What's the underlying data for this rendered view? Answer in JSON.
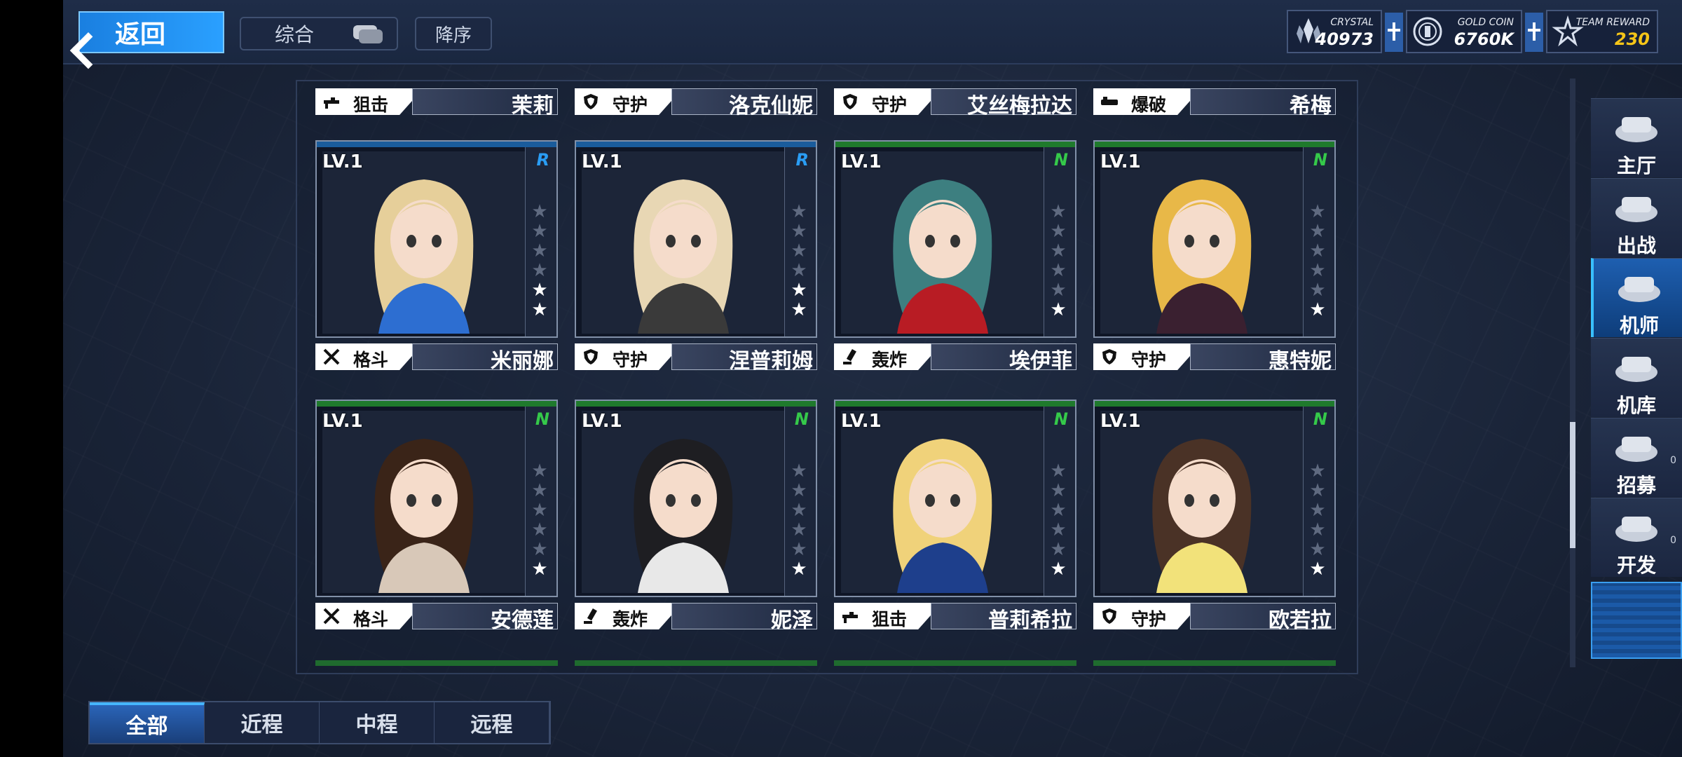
{
  "topbar": {
    "back_label": "返回",
    "filter_label": "综合",
    "sort_label": "降序"
  },
  "currencies": [
    {
      "label": "CRYSTAL",
      "value": "40973",
      "color": "#ffffff"
    },
    {
      "label": "GOLD COIN",
      "value": "6760K",
      "color": "#ffffff"
    },
    {
      "label": "TEAM REWARD",
      "value": "230",
      "color": "#f5c518"
    }
  ],
  "class_labels": {
    "snipe": "狙击",
    "guard": "守护",
    "blast": "爆破",
    "melee": "格斗",
    "bomb": "轰炸"
  },
  "top_row_tags": [
    {
      "class": "狙击",
      "name": "茉莉"
    },
    {
      "class": "守护",
      "name": "洛克仙妮"
    },
    {
      "class": "守护",
      "name": "艾丝梅拉达"
    },
    {
      "class": "爆破",
      "name": "希梅"
    }
  ],
  "cards": [
    {
      "level": "LV.1",
      "rarity": "R",
      "rarity_color": "#2a9df4",
      "stars_on": 2,
      "class": "格斗",
      "name": "米丽娜",
      "top_color": "#1a5c9c",
      "palette": [
        "#e6cf9a",
        "#2d6ed1"
      ]
    },
    {
      "level": "LV.1",
      "rarity": "R",
      "rarity_color": "#2a9df4",
      "stars_on": 2,
      "class": "守护",
      "name": "涅普莉姆",
      "top_color": "#1a5c9c",
      "palette": [
        "#e8d7b4",
        "#3a3a3a"
      ]
    },
    {
      "level": "LV.1",
      "rarity": "N",
      "rarity_color": "#35c94a",
      "stars_on": 1,
      "class": "轰炸",
      "name": "埃伊菲",
      "top_color": "#1f7a2c",
      "palette": [
        "#3d7f80",
        "#b81c24"
      ]
    },
    {
      "level": "LV.1",
      "rarity": "N",
      "rarity_color": "#35c94a",
      "stars_on": 1,
      "class": "守护",
      "name": "惠特妮",
      "top_color": "#1f7a2c",
      "palette": [
        "#e8b848",
        "#3a2030"
      ]
    },
    {
      "level": "LV.1",
      "rarity": "N",
      "rarity_color": "#35c94a",
      "stars_on": 1,
      "class": "格斗",
      "name": "安德莲",
      "top_color": "#1f7a2c",
      "palette": [
        "#3a2418",
        "#d8c8b8"
      ]
    },
    {
      "level": "LV.1",
      "rarity": "N",
      "rarity_color": "#35c94a",
      "stars_on": 1,
      "class": "轰炸",
      "name": "妮泽",
      "top_color": "#1f7a2c",
      "palette": [
        "#1e1e22",
        "#e8e8e8"
      ]
    },
    {
      "level": "LV.1",
      "rarity": "N",
      "rarity_color": "#35c94a",
      "stars_on": 1,
      "class": "狙击",
      "name": "普莉希拉",
      "top_color": "#1f7a2c",
      "palette": [
        "#f0d27a",
        "#1e3f8c"
      ]
    },
    {
      "level": "LV.1",
      "rarity": "N",
      "rarity_color": "#35c94a",
      "stars_on": 1,
      "class": "守护",
      "name": "欧若拉",
      "top_color": "#1f7a2c",
      "palette": [
        "#4a3226",
        "#f2e27a"
      ]
    }
  ],
  "right_nav": [
    {
      "label": "主厅",
      "icon": "hall-icon"
    },
    {
      "label": "出战",
      "icon": "sortie-icon"
    },
    {
      "label": "机师",
      "icon": "pilot-icon",
      "active": true
    },
    {
      "label": "机库",
      "icon": "hangar-icon"
    },
    {
      "label": "招募",
      "icon": "recruit-icon",
      "badge": "0"
    },
    {
      "label": "开发",
      "icon": "develop-icon",
      "badge": "0"
    }
  ],
  "bottom_tabs": [
    {
      "label": "全部",
      "active": true
    },
    {
      "label": "近程"
    },
    {
      "label": "中程"
    },
    {
      "label": "远程"
    }
  ]
}
